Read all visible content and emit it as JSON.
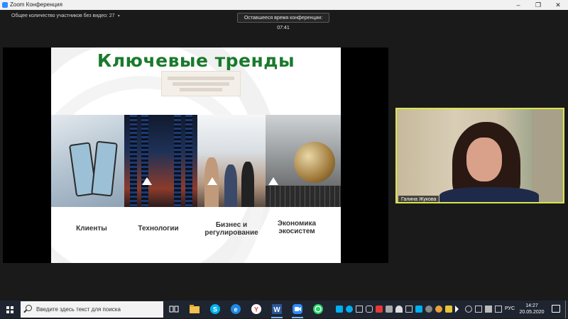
{
  "window": {
    "title": "Zoom Конференция",
    "controls": {
      "minimize": "–",
      "maximize": "❐",
      "close": "✕"
    }
  },
  "meeting": {
    "participants_without_video": "Общее количество участников без видео: 27",
    "caret": "▾",
    "remaining_time": "Оставшееся время конференции: 07:41"
  },
  "slide": {
    "title": "Ключевые тренды",
    "labels": {
      "clients": "Клиенты",
      "technology": "Технологии",
      "business_line1": "Бизнес и",
      "business_line2": "регулирование",
      "ecosystem_line1": "Экономика",
      "ecosystem_line2": "экосистем"
    }
  },
  "video": {
    "participant_name": "Галина Жукова"
  },
  "taskbar": {
    "search_placeholder": "Введите здесь текст для поиска",
    "language": "РУС",
    "time": "14:27",
    "date": "20.05.2020",
    "apps": [
      "task-view",
      "file-explorer",
      "skype",
      "edge",
      "yandex-browser",
      "word",
      "zoom",
      "whatsapp"
    ],
    "colors": {
      "taskbar": "#1f2530",
      "zoom": "#2d8cff",
      "video_border": "#d7e84a",
      "slide_title": "#1a7a2c"
    }
  }
}
